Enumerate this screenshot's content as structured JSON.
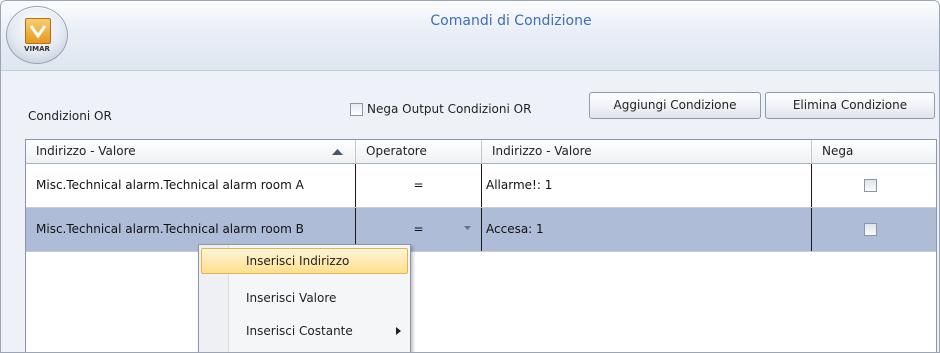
{
  "window": {
    "title": "Comandi di Condizione",
    "logo_text": "VIMAR"
  },
  "toolbar": {
    "section_label": "Condizioni OR",
    "negate_output_label": "Nega Output Condizioni OR",
    "negate_output_checked": false,
    "add_label": "Aggiungi Condizione",
    "delete_label": "Elimina Condizione"
  },
  "grid": {
    "columns": [
      "Indirizzo - Valore",
      "Operatore",
      "Indirizzo - Valore",
      "Nega"
    ],
    "sort_icon": "sort-ascending-icon",
    "rows": [
      {
        "address": "Misc.Technical alarm.Technical alarm room A",
        "operator": "=",
        "value": "Allarme!: 1",
        "negate": false,
        "selected": false
      },
      {
        "address": "Misc.Technical alarm.Technical alarm room B",
        "operator": "=",
        "value": "Accesa: 1",
        "negate": false,
        "selected": true
      }
    ],
    "selected_row_color": "#aebcd8"
  },
  "context_menu": {
    "items": [
      {
        "label": "Inserisci Indirizzo",
        "highlighted": true
      },
      {
        "label": "Inserisci Valore",
        "highlighted": false
      },
      {
        "label": "Inserisci Costante",
        "highlighted": false,
        "has_submenu": true
      }
    ]
  },
  "colors": {
    "title_text": "#3c6fb4",
    "highlight": "#fddf8f"
  }
}
